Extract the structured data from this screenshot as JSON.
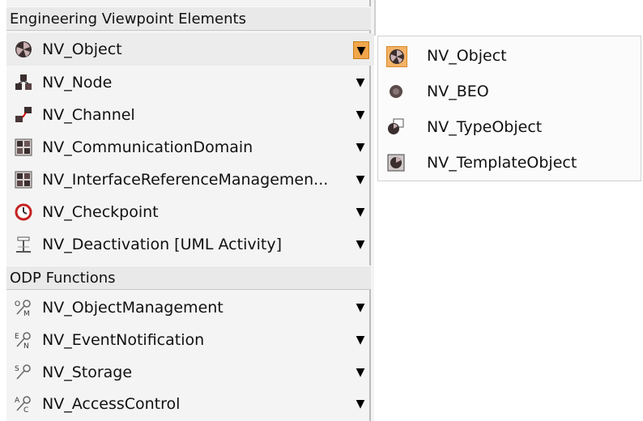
{
  "palette": {
    "sections": [
      {
        "header": "Engineering Viewpoint Elements",
        "items": [
          {
            "label": "NV_Object",
            "icon": "object-icon",
            "selected": true
          },
          {
            "label": "NV_Node",
            "icon": "node-icon"
          },
          {
            "label": "NV_Channel",
            "icon": "channel-icon"
          },
          {
            "label": "NV_CommunicationDomain",
            "icon": "communication-domain-icon"
          },
          {
            "label": "NV_InterfaceReferenceManagemen...",
            "icon": "interface-reference-icon"
          },
          {
            "label": "NV_Checkpoint",
            "icon": "checkpoint-icon"
          },
          {
            "label": "NV_Deactivation [UML Activity]",
            "icon": "deactivation-icon"
          }
        ]
      },
      {
        "header": "ODP Functions",
        "items": [
          {
            "label": "NV_ObjectManagement",
            "icon": "om-function-icon"
          },
          {
            "label": "NV_EventNotification",
            "icon": "en-function-icon"
          },
          {
            "label": "NV_Storage",
            "icon": "s-function-icon"
          },
          {
            "label": "NV_AccessControl",
            "icon": "ac-function-icon"
          }
        ]
      }
    ],
    "dropdown_glyph": "▼"
  },
  "submenu": {
    "items": [
      {
        "label": "NV_Object",
        "icon": "object-icon",
        "selected": true
      },
      {
        "label": "NV_BEO",
        "icon": "beo-icon"
      },
      {
        "label": "NV_TypeObject",
        "icon": "type-object-icon"
      },
      {
        "label": "NV_TemplateObject",
        "icon": "template-object-icon"
      }
    ]
  },
  "colors": {
    "selection_accent": "#f1a64a",
    "header_bg": "#e9e9e9",
    "palette_bg": "#f4f4f4"
  }
}
